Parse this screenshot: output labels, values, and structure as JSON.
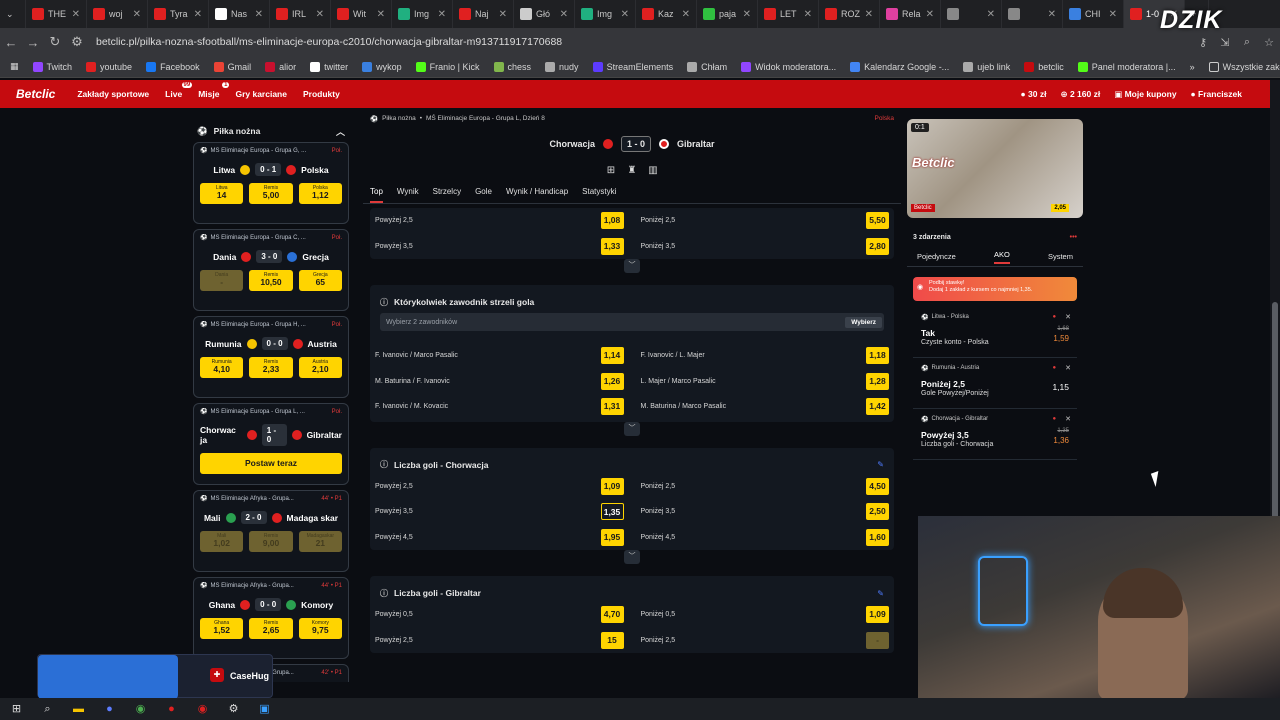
{
  "browser": {
    "tabs": [
      {
        "label": "THE",
        "color": "#e02020"
      },
      {
        "label": "woj",
        "color": "#e02020"
      },
      {
        "label": "Tyra",
        "color": "#e02020"
      },
      {
        "label": "Nas",
        "color": "#ffffff"
      },
      {
        "label": "IRL",
        "color": "#e02020"
      },
      {
        "label": "Wit",
        "color": "#e02020"
      },
      {
        "label": "Img",
        "color": "#20b080"
      },
      {
        "label": "Naj",
        "color": "#e02020"
      },
      {
        "label": "Głó",
        "color": "#cccccc"
      },
      {
        "label": "Img",
        "color": "#20b080"
      },
      {
        "label": "Kaz",
        "color": "#e02020"
      },
      {
        "label": "paja",
        "color": "#30c040"
      },
      {
        "label": "LET",
        "color": "#e02020"
      },
      {
        "label": "ROZ",
        "color": "#e02020"
      },
      {
        "label": "Rela",
        "color": "#e040a0"
      },
      {
        "label": "",
        "color": "#888888"
      },
      {
        "label": "",
        "color": "#888888"
      },
      {
        "label": "CHI",
        "color": "#3a80e0"
      },
      {
        "label": "1-0",
        "color": "#e02020",
        "active": true
      }
    ],
    "new_tab": "+",
    "url": "betclic.pl/pilka-nozna-sfootball/ms-eliminacje-europa-c2010/chorwacja-gibraltar-m913711917170688",
    "bookmarks": [
      {
        "label": "Twitch",
        "color": "#9146ff"
      },
      {
        "label": "youtube",
        "color": "#e02020"
      },
      {
        "label": "Facebook",
        "color": "#1877f2"
      },
      {
        "label": "Gmail",
        "color": "#ea4335"
      },
      {
        "label": "alior",
        "color": "#c8102e"
      },
      {
        "label": "twitter",
        "color": "#ffffff"
      },
      {
        "label": "wykop",
        "color": "#3a80e0"
      },
      {
        "label": "Franio | Kick",
        "color": "#53fc18"
      },
      {
        "label": "chess",
        "color": "#81b64c"
      },
      {
        "label": "nudy",
        "color": "#aaaaaa"
      },
      {
        "label": "StreamElements",
        "color": "#5c3bfe"
      },
      {
        "label": "Chłam",
        "color": "#aaaaaa"
      },
      {
        "label": "Widok moderatora...",
        "color": "#9146ff"
      },
      {
        "label": "Kalendarz Google -...",
        "color": "#4285f4"
      },
      {
        "label": "ujeb link",
        "color": "#aaaaaa"
      },
      {
        "label": "betclic",
        "color": "#c50b0f"
      },
      {
        "label": "Panel moderatora |...",
        "color": "#53fc18"
      }
    ],
    "bookmarks_more": "»",
    "all_bookmarks": "Wszystkie zakładki"
  },
  "site": {
    "logo": "Betclic",
    "nav": [
      {
        "label": "Zakłady sportowe"
      },
      {
        "label": "Live",
        "badge": "99"
      },
      {
        "label": "Misje",
        "badge": "1"
      },
      {
        "label": "Gry karciane"
      },
      {
        "label": "Produkty"
      }
    ],
    "balance1": "30 zł",
    "balance2": "2 160 zł",
    "coupons": "Moje kupony",
    "user": "Franciszek"
  },
  "sidebar": {
    "sport": "Piłka nożna",
    "matches": [
      {
        "league": "MŚ Eliminacje Europa - Grupa G, ...",
        "live": "Poł.",
        "home": "Litwa",
        "score": "0 - 1",
        "away": "Polska",
        "hc": "#f6c400",
        "ac": "#e02020",
        "odds": [
          {
            "n": "Litwa",
            "v": "14"
          },
          {
            "n": "Remis",
            "v": "5,00"
          },
          {
            "n": "Polska",
            "v": "1,12"
          }
        ],
        "dim": [
          false,
          false,
          false
        ]
      },
      {
        "league": "MŚ Eliminacje Europa - Grupa C, ...",
        "live": "Poł.",
        "home": "Dania",
        "score": "3 - 0",
        "away": "Grecja",
        "hc": "#e02020",
        "ac": "#2a70d6",
        "odds": [
          {
            "n": "Dania",
            "v": "-"
          },
          {
            "n": "Remis",
            "v": "10,50"
          },
          {
            "n": "Grecja",
            "v": "65"
          }
        ],
        "dim": [
          true,
          false,
          false
        ]
      },
      {
        "league": "MŚ Eliminacje Europa - Grupa H, ...",
        "live": "Poł.",
        "home": "Rumunia",
        "score": "0 - 0",
        "away": "Austria",
        "hc": "#f6c400",
        "ac": "#e02020",
        "odds": [
          {
            "n": "Rumunia",
            "v": "4,10"
          },
          {
            "n": "Remis",
            "v": "2,33"
          },
          {
            "n": "Austria",
            "v": "2,10"
          }
        ],
        "dim": [
          false,
          false,
          false
        ]
      },
      {
        "league": "MŚ Eliminacje Europa - Grupa L, ...",
        "live": "Poł.",
        "home": "Chorwac ja",
        "score": "1 - 0",
        "away": "Gibraltar",
        "hc": "#e02020",
        "ac": "#e02020",
        "cta": "Postaw teraz"
      },
      {
        "league": "MŚ Eliminacje Afryka - Grupa...",
        "live": "44' • P1",
        "home": "Mali",
        "score": "2 - 0",
        "away": "Madaga skar",
        "hc": "#2aa050",
        "ac": "#e02020",
        "odds": [
          {
            "n": "Mali",
            "v": "1,02"
          },
          {
            "n": "Remis",
            "v": "9,00"
          },
          {
            "n": "Madagaskar",
            "v": "21"
          }
        ],
        "dim": [
          true,
          true,
          true
        ]
      },
      {
        "league": "MŚ Eliminacje Afryka - Grupa...",
        "live": "44' • P1",
        "home": "Ghana",
        "score": "0 - 0",
        "away": "Komory",
        "hc": "#e02020",
        "ac": "#2aa050",
        "odds": [
          {
            "n": "Ghana",
            "v": "1,52"
          },
          {
            "n": "Remis",
            "v": "2,65"
          },
          {
            "n": "Komory",
            "v": "9,75"
          }
        ],
        "dim": [
          false,
          false,
          false
        ]
      },
      {
        "league": "MŚ Eliminacje Afryka - Grupa...",
        "live": "42' • P1",
        "home": "",
        "score": "",
        "away": "",
        "hc": "#888",
        "ac": "#888",
        "odds": []
      }
    ]
  },
  "match": {
    "breadcrumb": [
      "Piłka nożna",
      "•",
      "MŚ Eliminacje Europa - Grupa L, Dzień 8"
    ],
    "lang": "Polska",
    "home": "Chorwacja",
    "score": "1 - 0",
    "away": "Gibraltar",
    "tabs": [
      "Top",
      "Wynik",
      "Strzelcy",
      "Gole",
      "Wynik / Handicap",
      "Statystyki"
    ],
    "top_rows": [
      {
        "l": "Powyżej 2,5",
        "lv": "1,08",
        "r": "Poniżej 2,5",
        "rv": "5,50"
      },
      {
        "l": "Powyżej 3,5",
        "lv": "1,33",
        "r": "Poniżej 3,5",
        "rv": "2,80"
      }
    ],
    "scorer": {
      "title": "Którykolwiek zawodnik strzeli gola",
      "placeholder": "Wybierz 2 zawodników",
      "button": "Wybierz",
      "rows": [
        {
          "l": "F. Ivanovic / Marco Pasalic",
          "lv": "1,14",
          "r": "F. Ivanovic / L. Majer",
          "rv": "1,18"
        },
        {
          "l": "M. Baturina / F. Ivanovic",
          "lv": "1,26",
          "r": "L. Majer / Marco Pasalic",
          "rv": "1,28"
        },
        {
          "l": "F. Ivanovic / M. Kovacic",
          "lv": "1,31",
          "r": "M. Baturina / Marco Pasalic",
          "rv": "1,42"
        }
      ]
    },
    "goals_home": {
      "title": "Liczba goli - Chorwacja",
      "rows": [
        {
          "l": "Powyżej 2,5",
          "lv": "1,09",
          "r": "Poniżej 2,5",
          "rv": "4,50"
        },
        {
          "l": "Powyżej 3,5",
          "lv": "1,35",
          "r": "Poniżej 3,5",
          "rv": "2,50",
          "sel": true
        },
        {
          "l": "Powyżej 4,5",
          "lv": "1,95",
          "r": "Poniżej 4,5",
          "rv": "1,60"
        }
      ]
    },
    "goals_away": {
      "title": "Liczba goli - Gibraltar",
      "rows": [
        {
          "l": "Powyżej 0,5",
          "lv": "4,70",
          "r": "Poniżej 0,5",
          "rv": "1,09"
        },
        {
          "l": "Powyżej 2,5",
          "lv": "15",
          "r": "Poniżej 2,5",
          "rv": "-",
          "rdim": true
        }
      ]
    }
  },
  "stream": {
    "score_label": "0:1",
    "brand": "Betclic",
    "odd": "2,05"
  },
  "betslip": {
    "count": "3 zdarzenia",
    "dots": "•••",
    "tabs": [
      "Pojedyncze",
      "AKO",
      "System"
    ],
    "promo": "Podbij stawkę!\nDodaj 1 zakład z kursem co najmniej 1,35.",
    "bets": [
      {
        "event": "Litwa - Polska",
        "pick": "Tak",
        "market": "Czyste konto - Polska",
        "old": "1,68",
        "new": "1,59"
      },
      {
        "event": "Rumunia - Austria",
        "pick": "Poniżej 2,5",
        "market": "Gole Powyżej/Poniżej",
        "same": "1,15"
      },
      {
        "event": "Chorwacja - Gibraltar",
        "pick": "Powyżej 3,5",
        "market": "Liczba goli - Chorwacja",
        "old": "1,35",
        "new": "1,36"
      }
    ]
  },
  "overlay": {
    "brand": "DZIK",
    "casehug": "CaseHug"
  }
}
